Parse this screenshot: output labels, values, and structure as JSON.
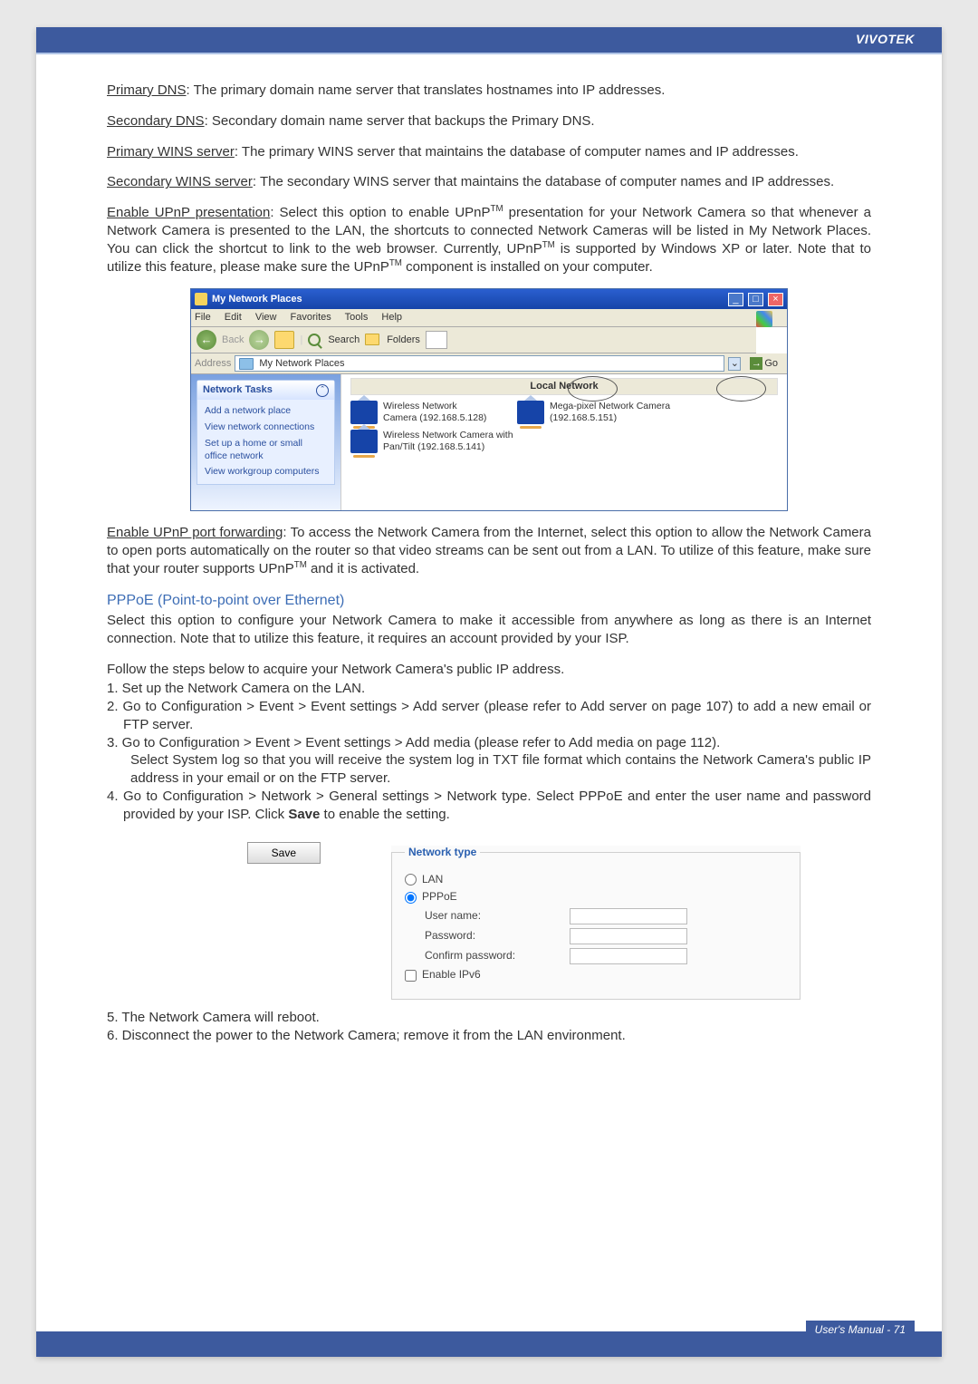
{
  "brand": "VIVOTEK",
  "footer": "User's Manual - 71",
  "para1a": "Primary DNS",
  "para1b": ": The primary domain name server that translates hostnames into IP addresses.",
  "para2a": "Secondary DNS",
  "para2b": ": Secondary domain name server that backups the Primary DNS.",
  "para3a": "Primary WINS server",
  "para3b": ": The primary WINS server that maintains the database of computer names and IP addresses.",
  "para4a": "Secondary WINS server",
  "para4b": ": The secondary WINS server that maintains the database of computer names and IP addresses.",
  "para5a": "Enable UPnP presentation",
  "para5b": ": Select this option to enable UPnP",
  "para5c": " presentation for your Network Camera so that whenever a Network Camera is presented to the LAN, the shortcuts to connected Network Cameras will be listed in My Network Places. You can click the shortcut to link to the web browser. Currently, UPnP",
  "para5d": " is supported by Windows XP or later. Note that to utilize this feature, please make sure the UPnP",
  "para5e": " component is installed on your computer.",
  "tm": "TM",
  "shot1": {
    "title": "My Network Places",
    "menus": [
      "File",
      "Edit",
      "View",
      "Favorites",
      "Tools",
      "Help"
    ],
    "back": "Back",
    "search": "Search",
    "folders": "Folders",
    "address": "Address",
    "addrval": "My Network Places",
    "go": "Go",
    "panel_title": "Network Tasks",
    "links": [
      "Add a network place",
      "View network connections",
      "Set up a home or small office network",
      "View workgroup computers"
    ],
    "local_network": "Local Network",
    "cam1": "Wireless Network Camera (192.168.5.128)",
    "cam2": "Mega-pixel Network Camera (192.168.5.151)",
    "cam3": "Wireless Network Camera with Pan/Tilt (192.168.5.141)"
  },
  "para6a": "Enable UPnP port forwarding",
  "para6b": ": To access the Network Camera from the Internet, select this option to allow the Network Camera to open ports automatically on the router so that video streams can be sent out from a LAN. To utilize of this feature, make sure that your router supports UPnP",
  "para6c": " and it is activated.",
  "section": "PPPoE (Point-to-point over Ethernet)",
  "para7": "Select this option to configure your Network Camera to make it accessible from anywhere as long as there is an Internet connection. Note that to utilize this feature, it requires an account provided by your ISP.",
  "para8": "Follow the steps below to acquire your Network Camera's public IP address.",
  "steps": {
    "s1": "1. Set up the Network Camera on the LAN.",
    "s2": "2. Go to Configuration > Event > Event settings > Add server (please refer to Add server on page 107) to add a new email or FTP server.",
    "s3": "3. Go to Configuration > Event > Event settings > Add media (please refer to Add media on page 112).",
    "s3b": "Select System log so that you will receive the system log in TXT file format which contains the Network Camera's public IP address in your email or on the FTP server.",
    "s4a": "4. Go to Configuration > Network > General settings > Network type. Select PPPoE and enter the user name and password provided by your ISP. Click ",
    "s4b": "Save",
    "s4c": " to enable the setting."
  },
  "shot2": {
    "legend": "Network type",
    "lan": "LAN",
    "pppoe": "PPPoE",
    "user": "User name:",
    "pass": "Password:",
    "conf": "Confirm password:",
    "ipv6": "Enable IPv6"
  },
  "save_btn": "Save",
  "steps2": {
    "s5": "5. The Network Camera will reboot.",
    "s6": "6. Disconnect the power to the Network Camera; remove it from the LAN environment."
  }
}
